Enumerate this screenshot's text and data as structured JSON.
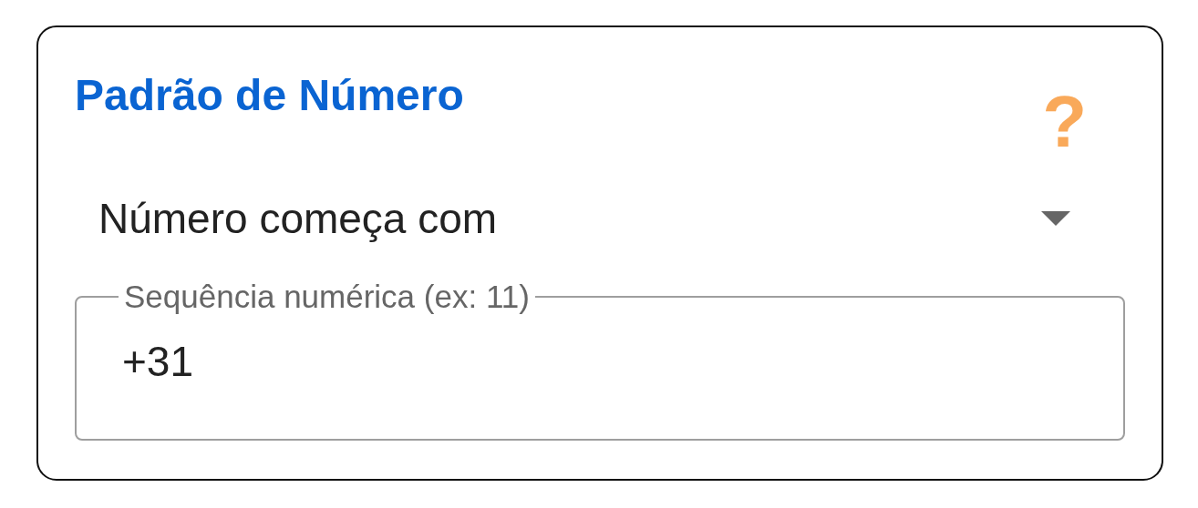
{
  "title": "Padrão de Número",
  "help_icon": "?",
  "dropdown": {
    "value": "Número começa com"
  },
  "field": {
    "label": "Sequência numérica (ex: 11)",
    "value": "+31"
  }
}
